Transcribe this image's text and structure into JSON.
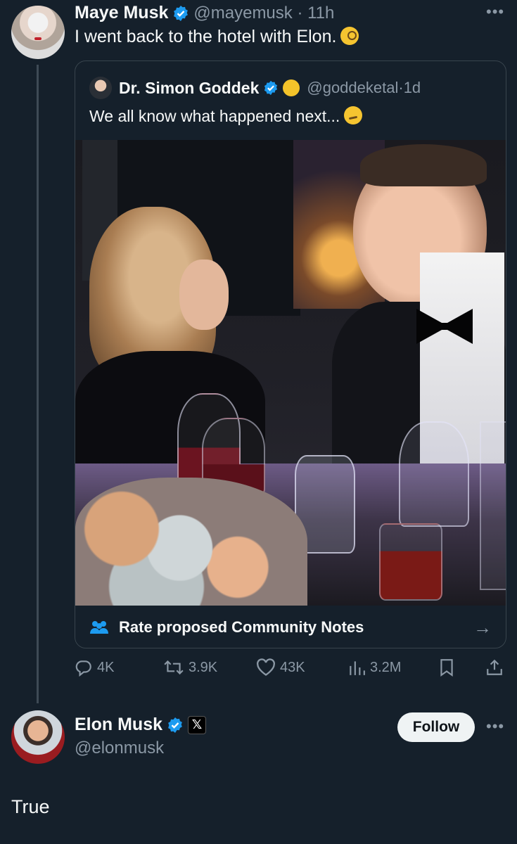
{
  "colors": {
    "background": "#15202b",
    "verified": "#1d9bf0",
    "muted": "#8b98a5",
    "text": "#f7f9f9",
    "follow_bg": "#eff3f4"
  },
  "tweet": {
    "author_name": "Maye Musk",
    "author_handle": "@mayemusk",
    "time": "11h",
    "text": "I went back to the hotel with Elon.",
    "emoji": "face-with-monocle",
    "more_icon": "more-dots-icon"
  },
  "quote": {
    "author_name": "Dr. Simon Goddek",
    "author_handle": "@goddeketal",
    "time": "1d",
    "text": "We all know what happened next...",
    "emoji": "smirking-face",
    "community_notes_label": "Rate proposed Community Notes"
  },
  "actions": {
    "replies": "4K",
    "reposts": "3.9K",
    "likes": "43K",
    "views": "3.2M"
  },
  "reply": {
    "author_name": "Elon Musk",
    "author_handle": "@elonmusk",
    "x_badge": "𝕏",
    "follow_label": "Follow",
    "text": "True"
  }
}
